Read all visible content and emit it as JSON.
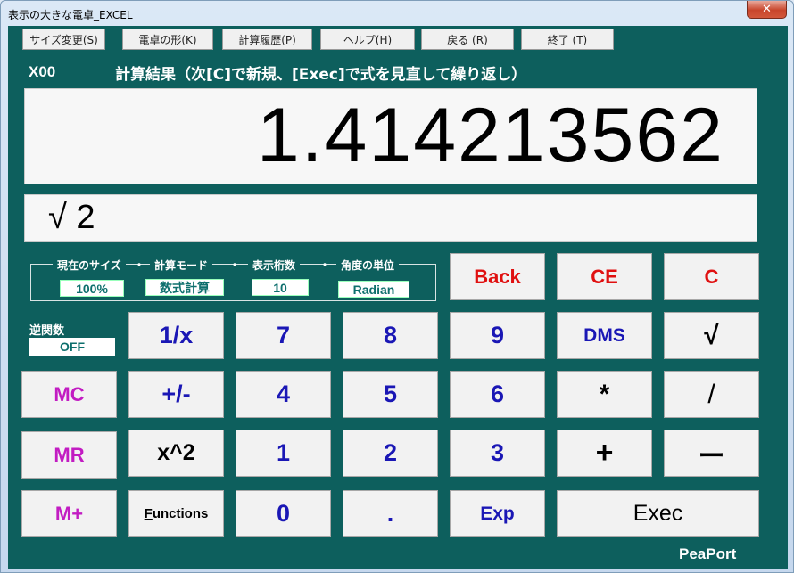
{
  "window": {
    "title": "表示の大きな電卓_EXCEL",
    "close_label": "✕"
  },
  "menu": [
    {
      "label": "サイズ変更(S)"
    },
    {
      "label": "電卓の形(K)"
    },
    {
      "label": "計算履歴(P)"
    },
    {
      "label": "ヘルプ(H)"
    },
    {
      "label": "戻る (R)"
    },
    {
      "label": "終了 (T)"
    }
  ],
  "status": {
    "mode_code": "X00",
    "hint": "計算結果（次[C]で新規、[Exec]で式を見直して繰り返し）"
  },
  "display": {
    "result": "1.414213562",
    "expression": "√ 2"
  },
  "settings": {
    "size_label": "現在のサイズ",
    "size_value": "100%",
    "calc_mode_label": "計算モード",
    "calc_mode_value": "数式計算",
    "digits_label": "表示桁数",
    "digits_value": "10",
    "angle_label": "角度の単位",
    "angle_value": "Radian",
    "separator": "・"
  },
  "inverse": {
    "label": "逆関数",
    "value": "OFF"
  },
  "keys": {
    "back": "Back",
    "ce": "CE",
    "c": "C",
    "reciprocal": "1/x",
    "seven": "7",
    "eight": "8",
    "nine": "9",
    "dms": "DMS",
    "sqrt": "√",
    "mc": "MC",
    "plus_minus": "+/-",
    "four": "4",
    "five": "5",
    "six": "6",
    "multiply": "*",
    "divide": "/",
    "mr": "MR",
    "square": "x^2",
    "one": "1",
    "two": "2",
    "three": "3",
    "plus": "+",
    "minus": "ー",
    "m_plus": "M+",
    "functions_first": "F",
    "functions_rest": "unctions",
    "zero": "0",
    "dot": ".",
    "exp": "Exp",
    "exec": "Exec"
  },
  "brand": "PeaPort",
  "colors": {
    "background": "#0d5f5d",
    "digit_key": "#1a17b5",
    "clear_key": "#e01010",
    "memory_key": "#c21cc2"
  }
}
